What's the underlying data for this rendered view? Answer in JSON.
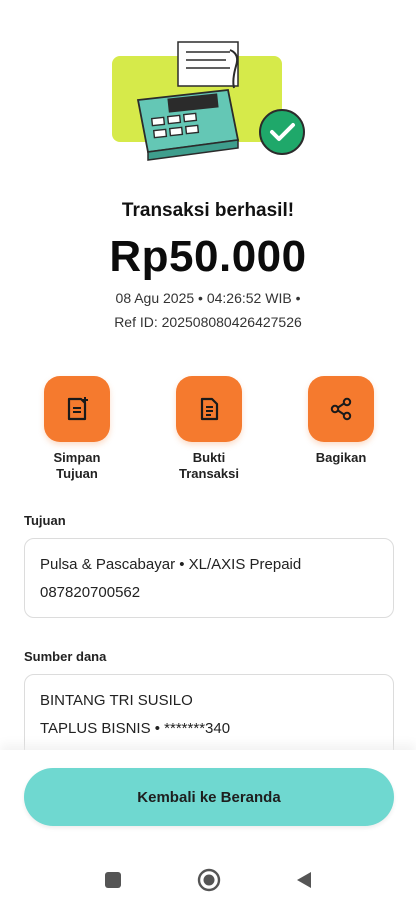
{
  "result": {
    "title": "Transaksi berhasil!",
    "amount": "Rp50.000",
    "datetime": "08 Agu 2025 • 04:26:52 WIB •",
    "ref_id": "Ref ID: 20250808042642752​6"
  },
  "actions": [
    {
      "line1": "Simpan",
      "line2": "Tujuan",
      "icon": "save-note-icon"
    },
    {
      "line1": "Bukti",
      "line2": "Transaksi",
      "icon": "receipt-icon"
    },
    {
      "line1": "Bagikan",
      "line2": "",
      "icon": "share-icon"
    }
  ],
  "tujuan": {
    "label": "Tujuan",
    "line1": "Pulsa & Pascabayar • XL/AXIS Prepaid",
    "line2": "087820700562"
  },
  "sumber": {
    "label": "Sumber dana",
    "line1": "BINTANG TRI SUSILO",
    "line2": "TAPLUS BISNIS • *******340"
  },
  "primary_button": "Kembali ke Beranda",
  "colors": {
    "accent_orange": "#f57a2e",
    "button_teal": "#6fd8d0",
    "success_green": "#1fa86a",
    "illustration_lime": "#d6ea4a"
  },
  "navigation": [
    "square-icon",
    "circle-home-icon",
    "triangle-back-icon"
  ]
}
